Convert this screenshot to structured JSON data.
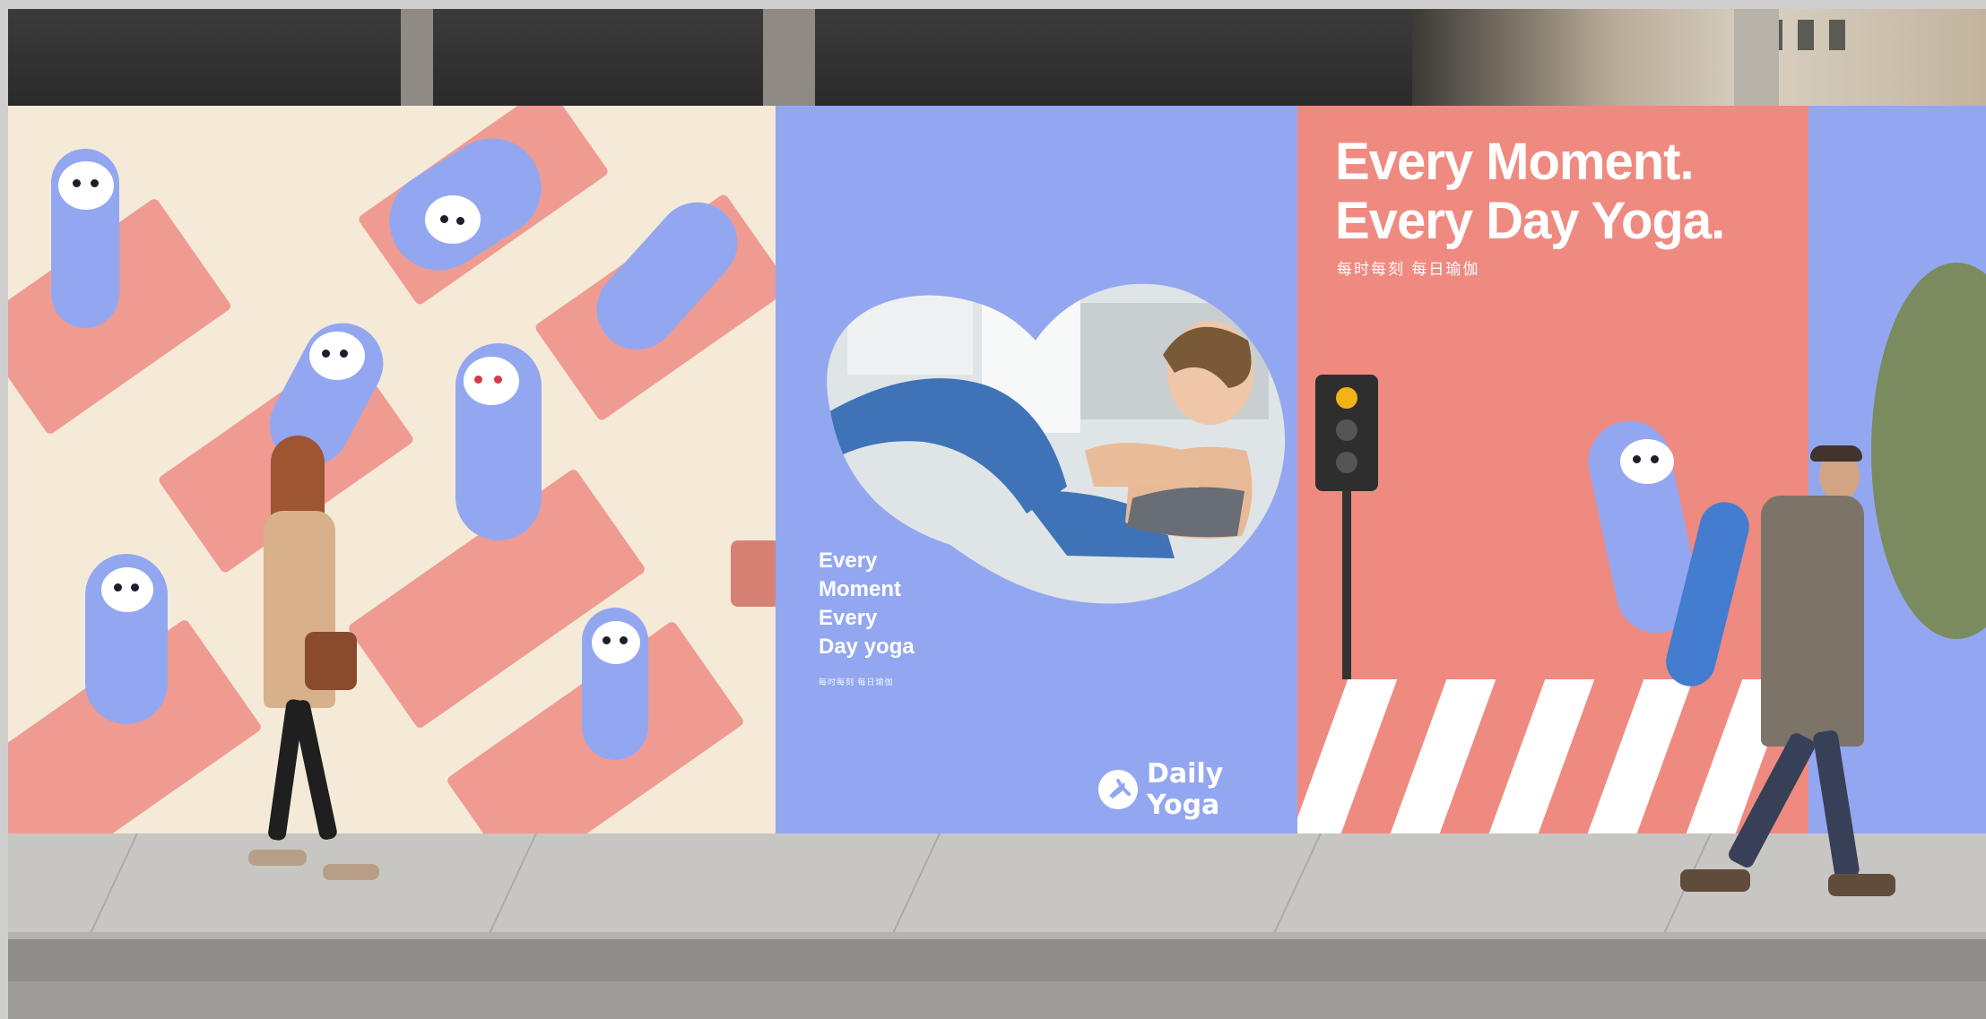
{
  "scene": {
    "billboards": [
      {
        "headline_lines": [
          "Every Moment.",
          "Every Day Yoga."
        ],
        "subtitle_cn": "每时每刻 每日瑜伽"
      },
      {
        "copy_lines": [
          "Every",
          "Moment",
          "Every",
          "Day yoga"
        ],
        "tiny_line": "每时每刻 每日瑜伽",
        "logo_text": "Daily Yoga"
      }
    ],
    "colors": {
      "lilac": "#93a7f1",
      "coral": "#ef8a80",
      "cream": "#f4ead7",
      "mat_pink": "#ef9b92"
    },
    "icons": {
      "logo": "daily-yoga-mark-icon",
      "mascot": "sloth-mascot-icon",
      "traffic": "traffic-light-icon"
    }
  }
}
